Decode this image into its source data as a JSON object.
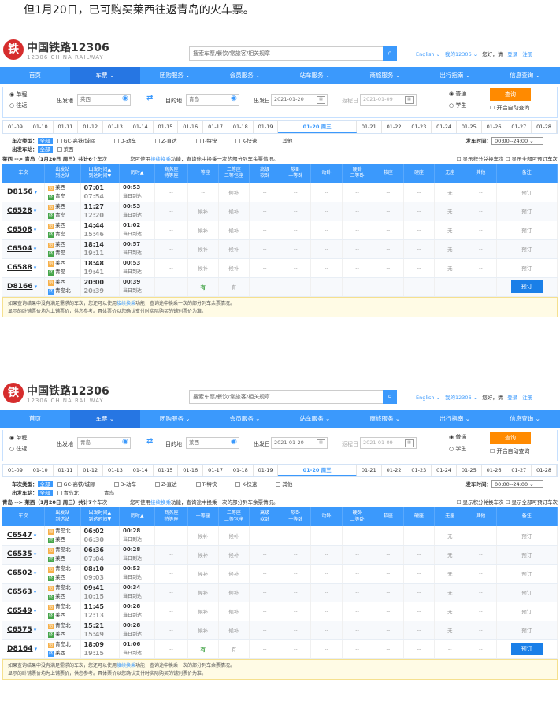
{
  "intro": "但1月20日，已可购买莱西往返青岛的火车票。",
  "header": {
    "logo_char": "铁",
    "logo_name": "中国铁路12306",
    "logo_sub": "12306 CHINA RAILWAY",
    "search_placeholder": "搜索车票/餐饮/常旅客/相关规章",
    "english": "English ⌄",
    "my12306": "我的12306 ⌄",
    "hello": "您好，请",
    "login": "登录",
    "register": "注册"
  },
  "nav": [
    "首页",
    "车票 ⌄",
    "团购服务 ⌄",
    "会员服务 ⌄",
    "站车服务 ⌄",
    "商旅服务 ⌄",
    "出行指南 ⌄",
    "信息查询 ⌄"
  ],
  "query_labels": {
    "oneway": "单程",
    "round": "往返",
    "from": "出发地",
    "to": "目的地",
    "date": "出发日",
    "return": "返程日",
    "adult": "普通",
    "student": "学生",
    "search": "查询",
    "auto": "开启自动查询"
  },
  "dates": [
    "01-09",
    "01-10",
    "01-11",
    "01-12",
    "01-13",
    "01-14",
    "01-15",
    "01-16",
    "01-17",
    "01-18",
    "01-19",
    "01-20 周三",
    "01-21",
    "01-22",
    "01-23",
    "01-24",
    "01-25",
    "01-26",
    "01-27",
    "01-28"
  ],
  "filters": {
    "type_label": "车次类型：",
    "all": "全部",
    "types": [
      "GC-高铁/城际",
      "D-动车",
      "Z-直达",
      "T-特快",
      "K-快速",
      "其他"
    ],
    "station_label": "出发车站：",
    "dep_label": "发车时间：",
    "dep_value": "00:00--24:00 ⌄"
  },
  "headers": [
    "车次",
    "出发站\n到达站",
    "出发时间▲\n到达时间▼",
    "历时▲",
    "商务座\n特等座",
    "一等座",
    "二等座\n二等包座",
    "高级\n软卧",
    "软卧\n一等卧",
    "动卧",
    "硬卧\n二等卧",
    "软座",
    "硬座",
    "无座",
    "其他",
    "备注"
  ],
  "sum_mid_pre": "您可使用",
  "sum_mid_link": "接续换乘",
  "sum_mid_post": "功能，查询途中换乘一次的部分列车余票情况。",
  "sum_right": "☐ 显示积分兑换车次   ☐ 显示全部可预订车次",
  "note_l1_pre": "如果查询结果中没有满足需求的车次，您还可以使用",
  "note_link": "接续换乘",
  "note_l1_post": "功能，查询途中换乘一次的部分列车余票情况。",
  "note_l2": "显示的卧铺票价均为上铺票价，供您参考。具体票价以您确认支付时实际购买的铺别票价为准。",
  "book_label": "预订",
  "panel1": {
    "from": "莱西",
    "to": "青岛",
    "date": "2021-01-20",
    "return": "2021-01-09",
    "stations": [
      "莱西"
    ],
    "sum_pre": "莱西 --> 青岛（1月20日 周三）共计",
    "sum_count": "6",
    "sum_post": "个车次",
    "trains": [
      {
        "no": "D8156",
        "from": "莱西",
        "to": "青岛",
        "dep": "07:01",
        "arr": "07:54",
        "dur": "00:53",
        "day": "当日到达",
        "fc": "--",
        "ec": "--",
        "sc": "候补",
        "wz": "无",
        "bk": "预订",
        "active": false
      },
      {
        "no": "C6528",
        "from": "莱西",
        "to": "青岛",
        "dep": "11:27",
        "arr": "12:20",
        "dur": "00:53",
        "day": "当日到达",
        "fc": "候补",
        "ec": "--",
        "sc": "候补",
        "wz": "无",
        "bk": "预订",
        "active": false
      },
      {
        "no": "C6508",
        "from": "莱西",
        "to": "青岛",
        "dep": "14:44",
        "arr": "15:46",
        "dur": "01:02",
        "day": "当日到达",
        "fc": "候补",
        "ec": "--",
        "sc": "候补",
        "wz": "无",
        "bk": "预订",
        "active": false
      },
      {
        "no": "C6504",
        "from": "莱西",
        "to": "青岛",
        "dep": "18:14",
        "arr": "19:11",
        "dur": "00:57",
        "day": "当日到达",
        "fc": "候补",
        "ec": "--",
        "sc": "候补",
        "wz": "无",
        "bk": "预订",
        "active": false
      },
      {
        "no": "C6588",
        "from": "莱西",
        "to": "青岛",
        "dep": "18:48",
        "arr": "19:41",
        "dur": "00:53",
        "day": "当日到达",
        "fc": "候补",
        "ec": "--",
        "sc": "候补",
        "wz": "无",
        "bk": "预订",
        "active": false
      },
      {
        "no": "D8166",
        "from": "莱西",
        "to": "青岛北",
        "dep": "20:00",
        "arr": "20:39",
        "dur": "00:39",
        "day": "当日到达",
        "fc": "有",
        "ec": "--",
        "sc": "有",
        "wz": "--",
        "bk": "预订",
        "active": true
      }
    ]
  },
  "panel2": {
    "from": "青岛",
    "to": "莱西",
    "date": "2021-01-20",
    "return": "2021-01-09",
    "stations": [
      "青岛北",
      "青岛"
    ],
    "sum_pre": "青岛 --> 莱西（1月20日 周三）共计",
    "sum_count": "7",
    "sum_post": "个车次",
    "trains": [
      {
        "no": "C6547",
        "from": "青岛北",
        "to": "莱西",
        "dep": "06:02",
        "arr": "06:30",
        "dur": "00:28",
        "day": "当日到达",
        "fc": "候补",
        "ec": "--",
        "sc": "候补",
        "wz": "无",
        "bk": "预订",
        "active": false
      },
      {
        "no": "C6535",
        "from": "青岛北",
        "to": "莱西",
        "dep": "06:36",
        "arr": "07:04",
        "dur": "00:28",
        "day": "当日到达",
        "fc": "候补",
        "ec": "候补",
        "sc": "候补",
        "wz": "无",
        "bk": "预订",
        "active": false
      },
      {
        "no": "C6502",
        "from": "青岛北",
        "to": "莱西",
        "dep": "08:10",
        "arr": "09:03",
        "dur": "00:53",
        "day": "当日到达",
        "fc": "候补",
        "ec": "--",
        "sc": "候补",
        "wz": "无",
        "bk": "预订",
        "active": false
      },
      {
        "no": "C6563",
        "from": "青岛北",
        "to": "莱西",
        "dep": "09:41",
        "arr": "10:15",
        "dur": "00:34",
        "day": "当日到达",
        "fc": "候补",
        "ec": "--",
        "sc": "候补",
        "wz": "无",
        "bk": "预订",
        "active": false
      },
      {
        "no": "C6549",
        "from": "青岛北",
        "to": "莱西",
        "dep": "11:45",
        "arr": "12:13",
        "dur": "00:28",
        "day": "当日到达",
        "fc": "候补",
        "ec": "--",
        "sc": "候补",
        "wz": "无",
        "bk": "预订",
        "active": false
      },
      {
        "no": "C6575",
        "from": "青岛北",
        "to": "莱西",
        "dep": "15:21",
        "arr": "15:49",
        "dur": "00:28",
        "day": "当日到达",
        "fc": "候补",
        "ec": "--",
        "sc": "候补",
        "wz": "无",
        "bk": "预订",
        "active": false
      },
      {
        "no": "D8164",
        "from": "青岛北",
        "to": "莱西",
        "dep": "18:09",
        "arr": "19:15",
        "dur": "01:06",
        "day": "当日到达",
        "fc": "有",
        "ec": "--",
        "sc": "有",
        "wz": "--",
        "bk": "预订",
        "active": true
      }
    ]
  }
}
